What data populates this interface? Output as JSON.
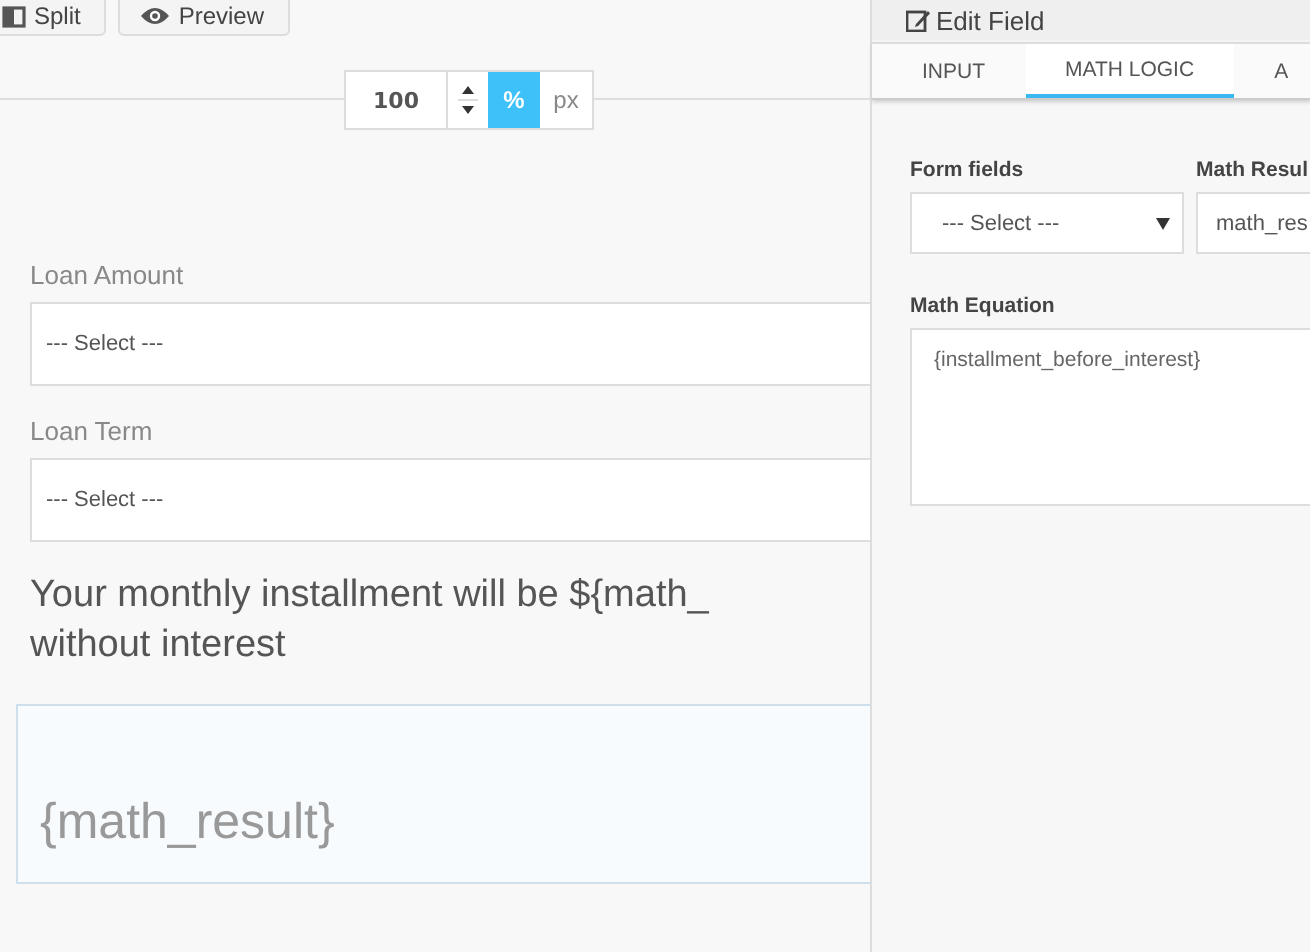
{
  "toolbar": {
    "buttons": [
      {
        "kind": "split",
        "label": "Split"
      },
      {
        "kind": "preview",
        "label": "Preview"
      }
    ]
  },
  "zoom": {
    "value": "100",
    "units": [
      {
        "label": "%",
        "selected": true
      },
      {
        "label": "px",
        "selected": false
      }
    ]
  },
  "form": {
    "fields": [
      {
        "label": "Loan Amount",
        "value": "--- Select ---"
      },
      {
        "label": "Loan Term",
        "value": "--- Select ---"
      }
    ],
    "heading_lines": [
      "Your monthly installment will be ${math_",
      "without interest"
    ],
    "result": "{math_result}"
  },
  "panel": {
    "title": "Edit Field",
    "tabs": [
      {
        "label": "INPUT",
        "selected": false
      },
      {
        "label": "MATH LOGIC",
        "selected": true
      },
      {
        "label": "A",
        "selected": false
      }
    ],
    "form_fields": {
      "label": "Form fields",
      "value": "--- Select ---"
    },
    "math_result": {
      "label": "Math Resul",
      "value": "math_res"
    },
    "equation": {
      "label": "Math Equation",
      "value": "{installment_before_interest}"
    }
  }
}
